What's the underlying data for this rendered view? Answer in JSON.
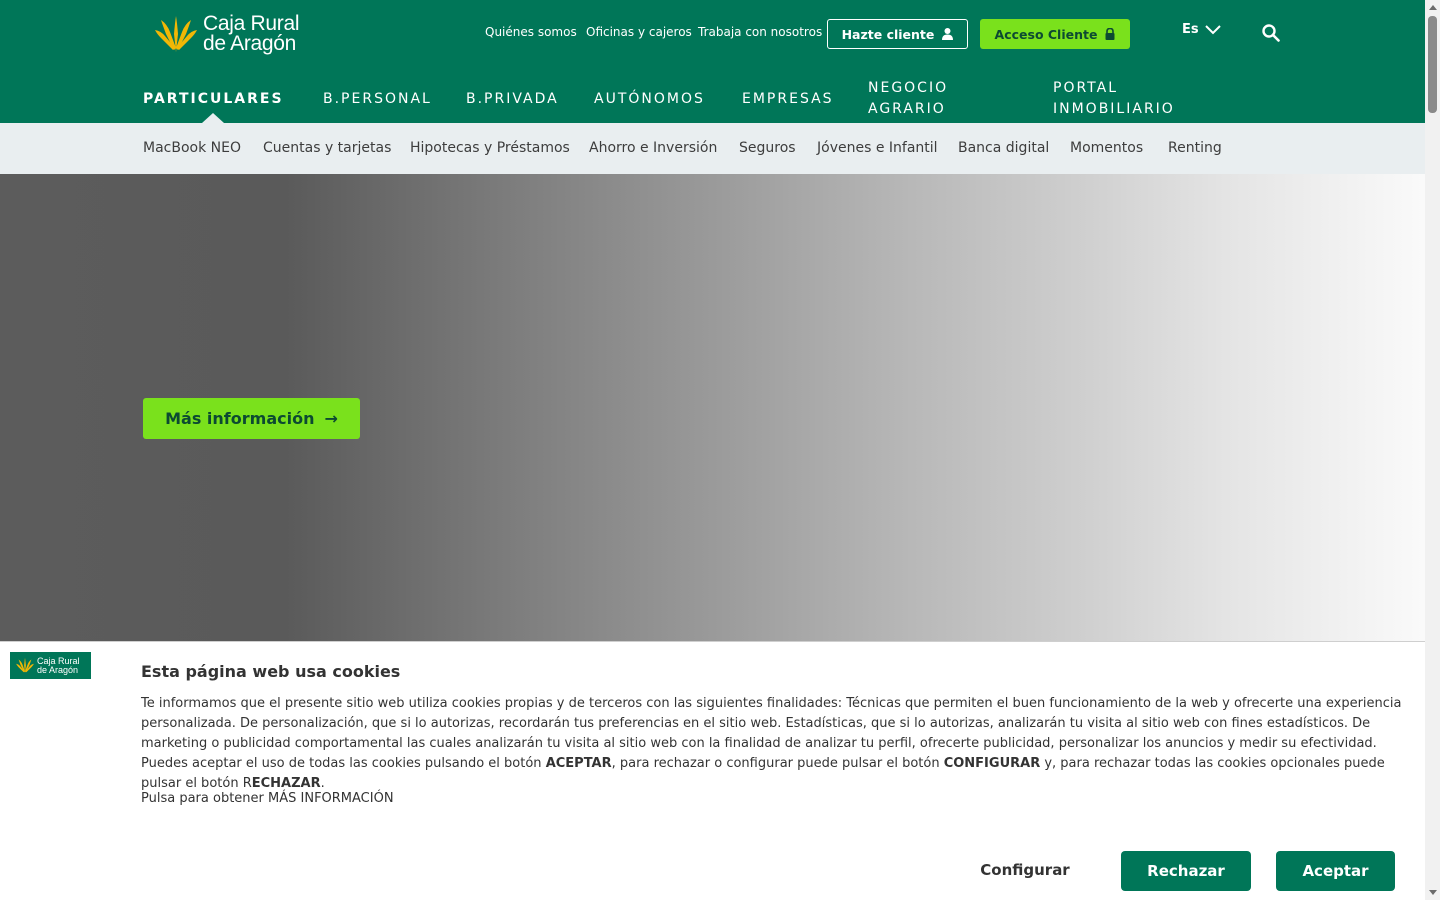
{
  "brand": {
    "name_line1": "Caja Rural",
    "name_line2": "de Aragón",
    "primary_color": "#007658",
    "accent_color": "#7ae11c"
  },
  "utility_nav": {
    "links": [
      "Quiénes somos",
      "Oficinas y cajeros",
      "Trabaja con nosotros"
    ],
    "hazte_cliente": "Hazte cliente",
    "acceso_cliente": "Acceso Cliente",
    "language": "Es"
  },
  "main_nav": {
    "items": [
      "PARTICULARES",
      "B.PERSONAL",
      "B.PRIVADA",
      "AUTÓNOMOS",
      "EMPRESAS"
    ],
    "negocio_agrario": [
      "NEGOCIO",
      "AGRARIO"
    ],
    "portal_inmobiliario": [
      "PORTAL",
      "INMOBILIARIO"
    ],
    "active": "PARTICULARES"
  },
  "sub_nav": {
    "items": [
      "MacBook NEO",
      "Cuentas y tarjetas",
      "Hipotecas y Préstamos",
      "Ahorro e Inversión",
      "Seguros",
      "Jóvenes e Infantil",
      "Banca digital",
      "Momentos",
      "Renting"
    ]
  },
  "hero": {
    "button_label": "Más información",
    "button_arrow": "→"
  },
  "cookie_banner": {
    "logo_line1": "Caja Rural",
    "logo_line2": "de Aragón",
    "title": "Esta página web usa cookies",
    "body_part1": "Te informamos que el presente sitio web utiliza cookies propias y de terceros con las siguientes finalidades: Técnicas que permiten el buen funcionamiento de la web y ofrecerte una experiencia personalizada. De personalización, que si lo autorizas, recordarán tus preferencias en el sitio web. Estadísticas, que si lo autorizas, analizarán tu visita al sitio web con fines estadísticos. De marketing o publicidad comportamental las cuales analizarán tu visita al sitio web con la finalidad de analizar tu perfil, ofrecerte publicidad, personalizar los anuncios y medir su efectividad. Puedes aceptar el uso de todas las cookies pulsando el botón ",
    "body_bold1": "ACEPTAR",
    "body_part2": ", para rechazar o configurar puede pulsar el botón ",
    "body_bold2": "CONFIGURAR",
    "body_part3": " y, para rechazar todas las cookies opcionales puede pulsar el botón R",
    "body_bold3": "ECHAZAR",
    "body_part4": ".",
    "more_info": "Pulsa para obtener MÁS INFORMACIÓN",
    "configurar": "Configurar",
    "rechazar": "Rechazar",
    "aceptar": "Aceptar"
  }
}
